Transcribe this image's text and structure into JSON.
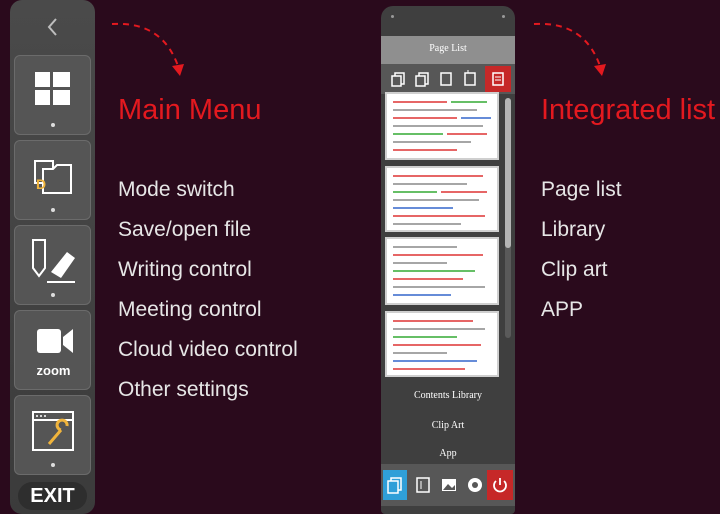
{
  "left_menu": {
    "heading": "Main Menu",
    "items": [
      "Mode switch",
      "Save/open file",
      "Writing control",
      "Meeting control",
      "Cloud video control",
      "Other settings"
    ]
  },
  "right_menu": {
    "heading": "Integrated list",
    "items": [
      "Page list",
      "Library",
      "Clip art",
      "APP"
    ]
  },
  "toolbar": {
    "back_icon": "chevron-left-icon",
    "buttons": [
      "windows-icon",
      "folder-file-icon",
      "pen-eraser-icon",
      "zoom-camera-icon",
      "settings-wrench-icon"
    ],
    "file_letter": "D",
    "zoom_label": "zoom",
    "exit_label": "EXIT"
  },
  "panel": {
    "title": "Page List",
    "tabs": [
      "copy-icon",
      "copy-alt-icon",
      "page-icon",
      "page-alt-icon",
      "page-list-icon"
    ],
    "links": [
      "Contents Library",
      "Clip Art",
      "App"
    ],
    "bottom_icons": [
      "pages-icon",
      "library-icon",
      "image-icon",
      "app-icon",
      "power-icon"
    ]
  },
  "colors": {
    "accent": "#e3191f",
    "background": "#2a0a1c",
    "text": "#e6e6e6",
    "active_blue": "#2f9fd8"
  }
}
